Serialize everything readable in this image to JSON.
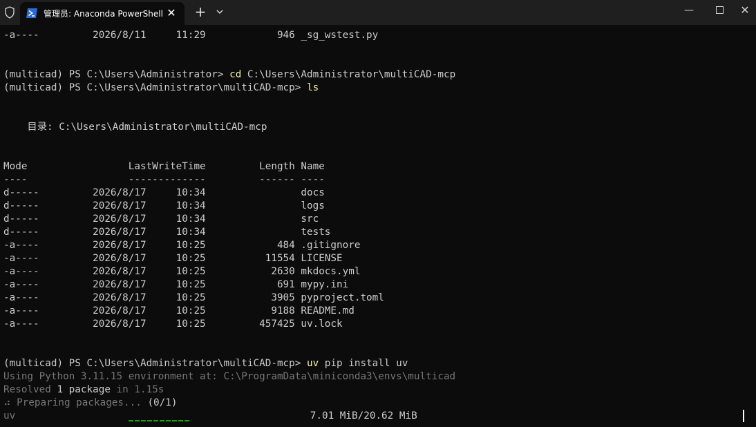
{
  "window": {
    "tab_title": "管理员: Anaconda PowerShell",
    "tab_close": "✕",
    "new_tab": "+",
    "minimize": "—",
    "close": "✕",
    "icons": {
      "shield": "shield-icon",
      "tab": "powershell-icon",
      "dropdown": "chevron-down-icon",
      "maximize": "maximize-icon"
    }
  },
  "terminal": {
    "lines": [
      {
        "text": "-a----         2026/8/11     11:29            946 _sg_wstest.py"
      },
      {
        "text": ""
      },
      {
        "text": ""
      },
      {
        "prompt": "(multicad) PS C:\\Users\\Administrator> ",
        "cmd": "cd",
        "args": " C:\\Users\\Administrator\\multiCAD-mcp"
      },
      {
        "prompt": "(multicad) PS C:\\Users\\Administrator\\multiCAD-mcp> ",
        "cmd": "ls",
        "args": ""
      },
      {
        "text": ""
      },
      {
        "text": ""
      },
      {
        "text": "    目录: C:\\Users\\Administrator\\multiCAD-mcp"
      },
      {
        "text": ""
      },
      {
        "text": ""
      },
      {
        "text": "Mode                 LastWriteTime         Length Name"
      },
      {
        "text": "----                 -------------         ------ ----"
      },
      {
        "text": "d-----         2026/8/17     10:34                docs"
      },
      {
        "text": "d-----         2026/8/17     10:34                logs"
      },
      {
        "text": "d-----         2026/8/17     10:34                src"
      },
      {
        "text": "d-----         2026/8/17     10:34                tests"
      },
      {
        "text": "-a----         2026/8/17     10:25            484 .gitignore"
      },
      {
        "text": "-a----         2026/8/17     10:25          11554 LICENSE"
      },
      {
        "text": "-a----         2026/8/17     10:25           2630 mkdocs.yml"
      },
      {
        "text": "-a----         2026/8/17     10:25            691 mypy.ini"
      },
      {
        "text": "-a----         2026/8/17     10:25           3905 pyproject.toml"
      },
      {
        "text": "-a----         2026/8/17     10:25           9188 README.md"
      },
      {
        "text": "-a----         2026/8/17     10:25         457425 uv.lock"
      },
      {
        "text": ""
      },
      {
        "text": ""
      },
      {
        "prompt": "(multicad) PS C:\\Users\\Administrator\\multiCAD-mcp> ",
        "cmd": "uv",
        "args": " pip install uv"
      },
      {
        "text": "Using Python 3.11.15 environment at: C:\\ProgramData\\miniconda3\\envs\\multicad",
        "style": "dim"
      },
      {
        "text": "Resolved ",
        "style": "dim",
        "bold_part": "1 package",
        "rest": " in 1.15s"
      },
      {
        "text": "⠴ Preparing packages... ",
        "style": "dim",
        "bold_part": "(0/1)",
        "rest": ""
      },
      {
        "text": "uv                   ",
        "style": "dim",
        "after_bar": "7.01 MiB/20.62 MiB"
      }
    ]
  },
  "progress": {
    "fraction": 0.34
  }
}
